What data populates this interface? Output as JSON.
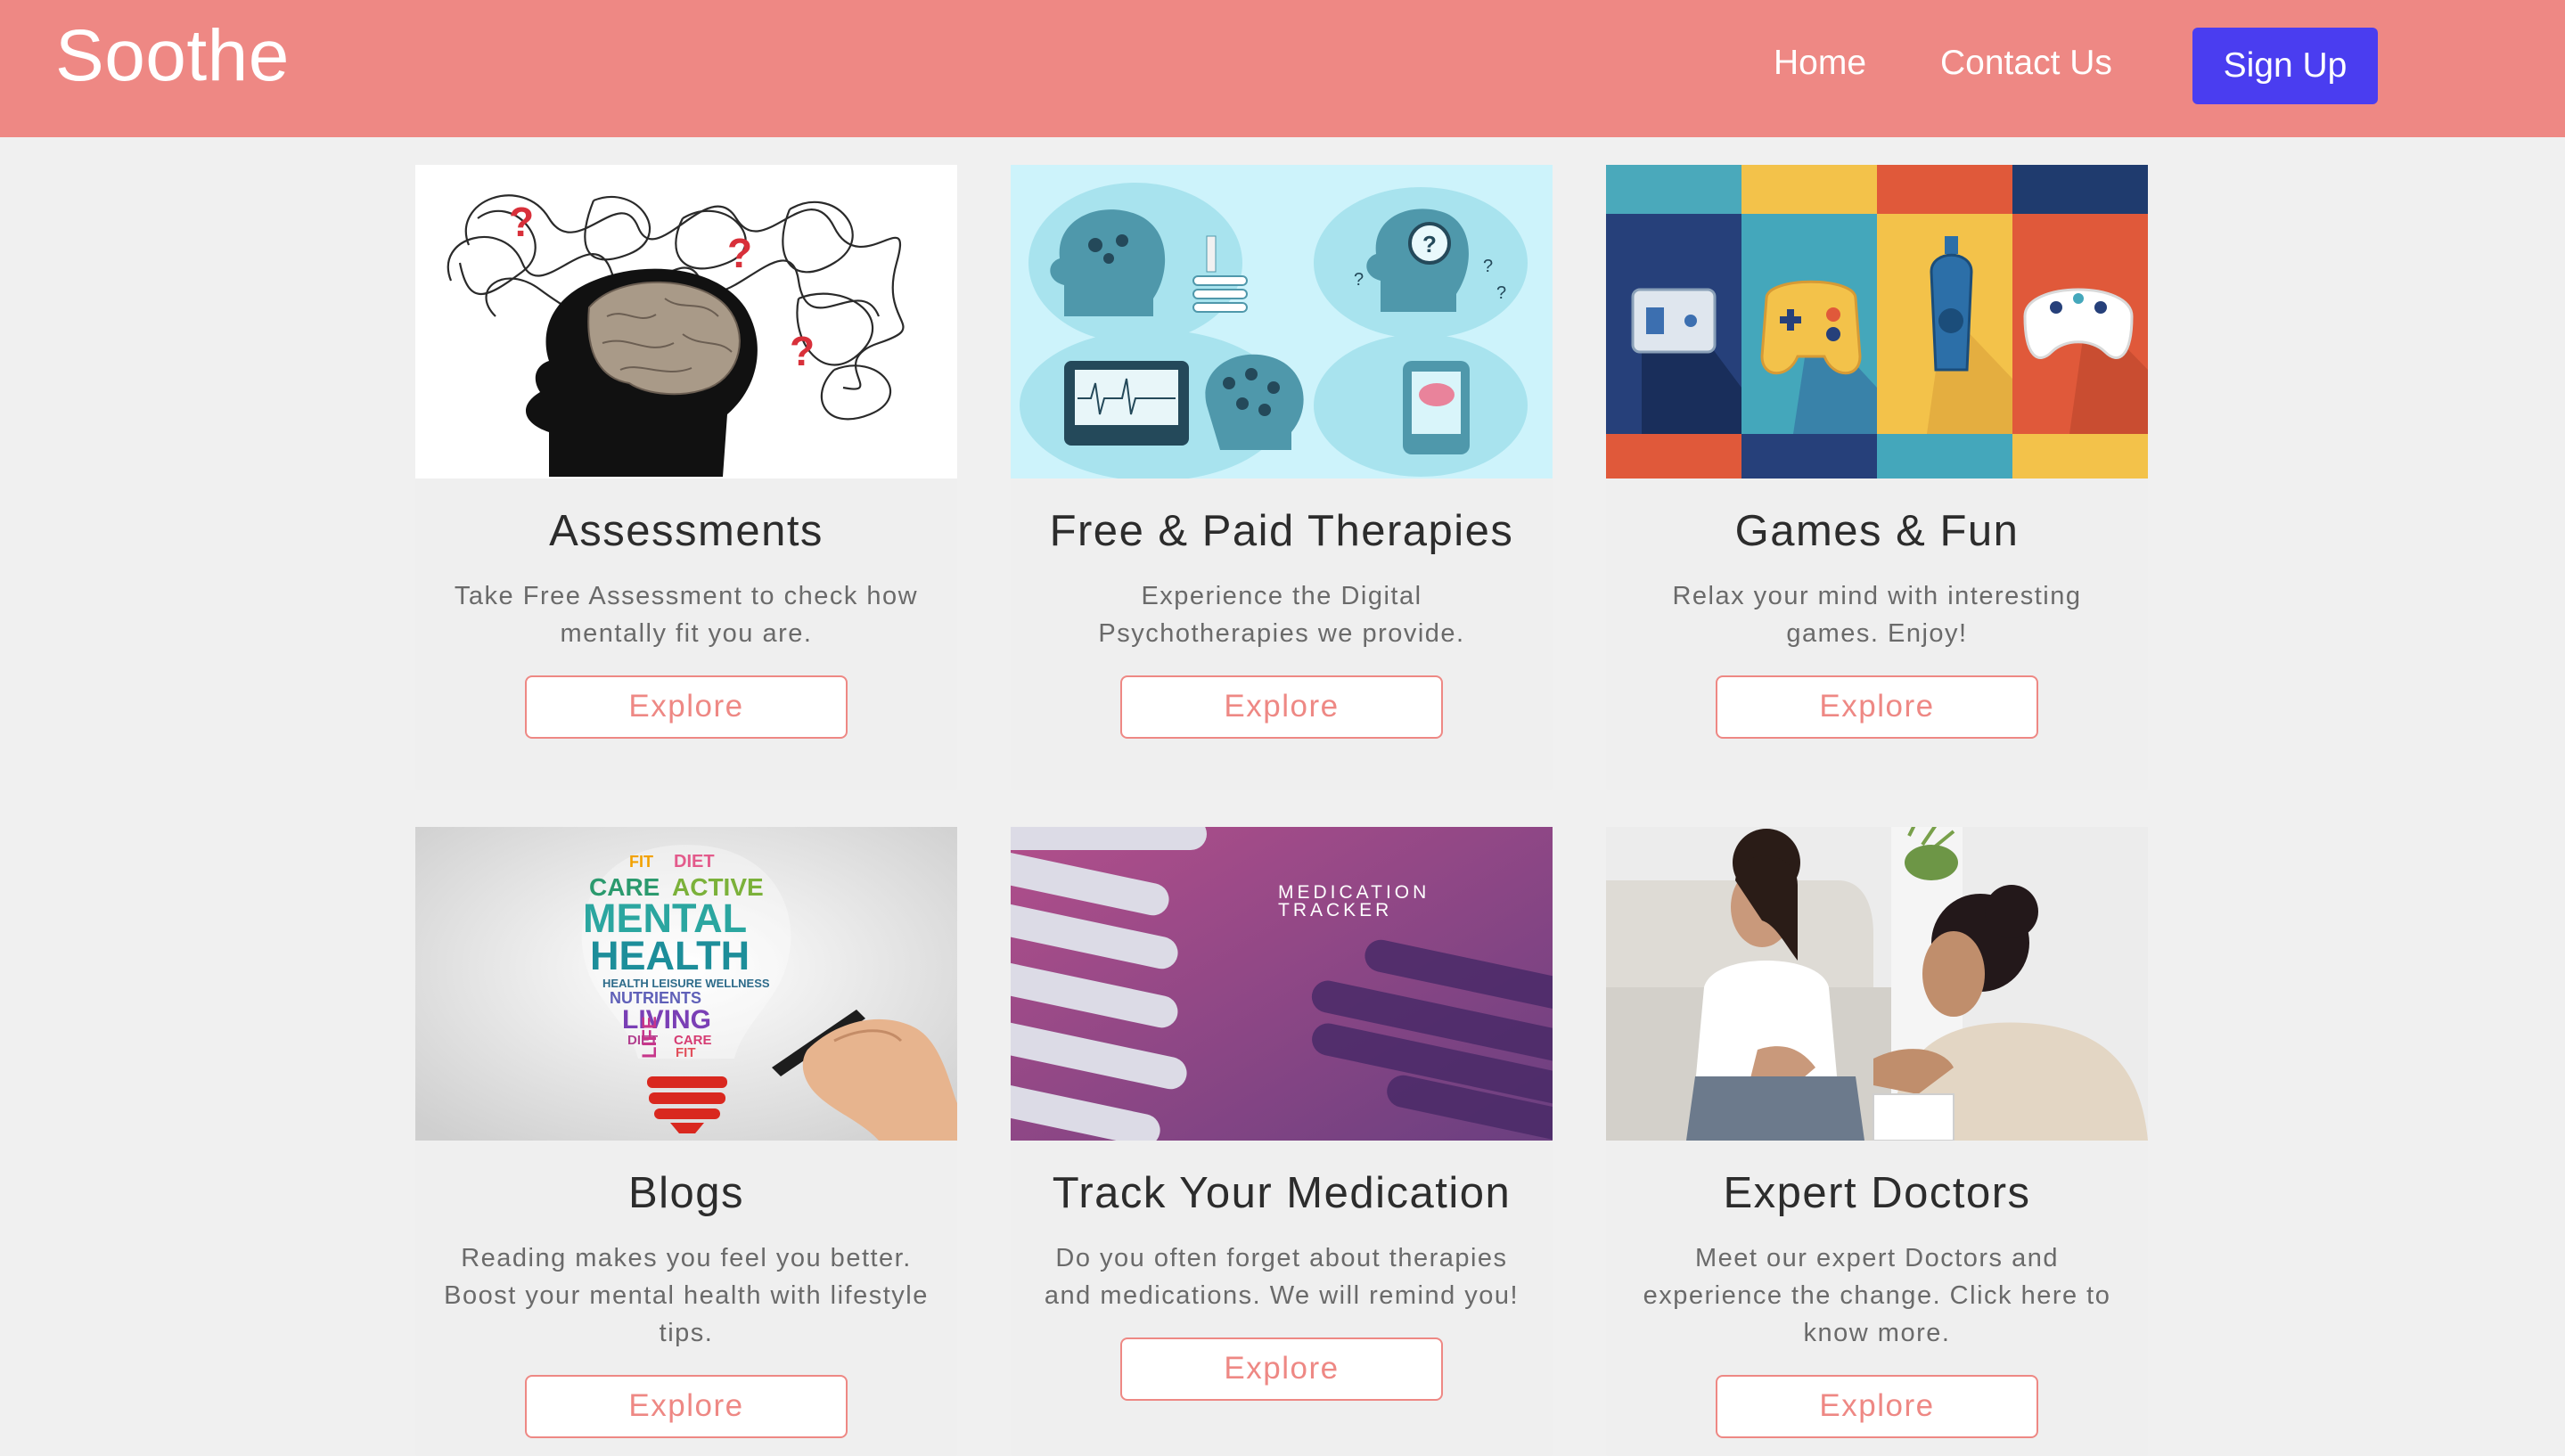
{
  "header": {
    "brand": "Soothe",
    "nav": {
      "home": "Home",
      "contact": "Contact Us",
      "signup": "Sign Up"
    },
    "colors": {
      "navbar_bg": "#ee8884",
      "signup_bg": "#4a3df0"
    }
  },
  "cards": [
    {
      "title": "Assessments",
      "text": "Take Free Assessment to check how mentally fit you are.",
      "button": "Explore",
      "image": "head-with-tangled-thoughts-illustration"
    },
    {
      "title": "Free & Paid Therapies",
      "text": "Experience the Digital Psychotherapies we provide.",
      "button": "Explore",
      "image": "digital-therapy-illustration"
    },
    {
      "title": "Games & Fun",
      "text": "Relax your mind with interesting games. Enjoy!",
      "button": "Explore",
      "image": "game-controllers-illustration"
    },
    {
      "title": "Blogs",
      "text": "Reading makes you feel you better. Boost your mental health with lifestyle tips.",
      "button": "Explore",
      "image": "mental-health-lightbulb-word-cloud"
    },
    {
      "title": "Track Your Medication",
      "text": "Do you often forget about therapies and medications. We will remind you!",
      "button": "Explore",
      "image": "medication-tracker-banner",
      "image_text": [
        "MEDICATION",
        "TRACKER"
      ]
    },
    {
      "title": "Expert Doctors",
      "text": "Meet our expert Doctors and experience the change. Click here to know more.",
      "button": "Explore",
      "image": "doctor-consultation-photo"
    }
  ],
  "lightbulb_words": [
    "FIT",
    "DIET",
    "CARE",
    "ACTIVE",
    "MENTAL",
    "HEALTH",
    "HEALTH LEISURE WELLNESS",
    "NUTRIENTS",
    "LIVING",
    "DIET",
    "LIFE",
    "CARE",
    "FIT"
  ],
  "accent_color": "#ee8884"
}
